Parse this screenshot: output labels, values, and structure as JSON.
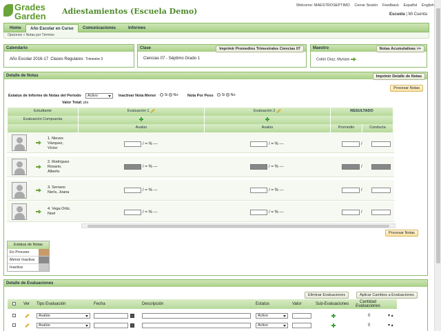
{
  "app": {
    "logo_line1": "Grades",
    "logo_line2": "Garden",
    "title": "Adiestamientos (Escuela Demo)"
  },
  "toplinks": {
    "welcome": "Welcome: MAESTROSEPTIMO",
    "logout": "Cerrar Sesión",
    "feedback": "Feedback",
    "spanish": "Español",
    "english": "English",
    "school": "Escuela",
    "sep": "|",
    "account": "Mi Cuenta"
  },
  "nav": {
    "tabs": [
      "Home",
      "Año Escolar en Curso",
      "Comunicaciones",
      "Informes"
    ],
    "breadcrumb_1": "Opciones",
    "breadcrumb_sep": "»",
    "breadcrumb_2": "Notas por Término"
  },
  "calendario": {
    "title": "Calendario",
    "year": "Año Escolar 2016-17",
    "program": "Clases Regulares",
    "term": "Trimestre 3"
  },
  "clase": {
    "title": "Clase",
    "print_button": "Imprimir Promedios Trimestrales Ciencias 07",
    "value": "Ciencias 07 - Séptimo Grado 1"
  },
  "maestro": {
    "title": "Maestro",
    "button": "Notas Acumulativas >>",
    "name": "Colón Díaz, Myriam"
  },
  "detalle_notas": {
    "title": "Detalle de Notas",
    "print_button": "Imprimir Detalle de Notas",
    "process_button": "Procesar Notas",
    "estatus_label": "Estatus de Informe de Notas del Periodo",
    "estatus_value": "Activo",
    "inactivar_label": "Inactivar Nota Menor",
    "nota_peso_label": "Nota Por Peso",
    "si": "Si",
    "no": "No",
    "valor_total_label": "Valor Total:",
    "valor_total_value": "pts",
    "col_estudiante": "Estudiante",
    "col_eval1": "Evaluación 1",
    "col_eval2": "Evaluación 2",
    "col_resultado": "RESULTADO",
    "col_eval_compuesta": "Evaluación Compuesta",
    "col_avaluo1": "Avalúo",
    "col_avaluo2": "Avalúo",
    "col_promedio": "Promedio",
    "col_conducta": "Conducta",
    "score_suffix": "/ = % ---",
    "slash": "/",
    "students": [
      {
        "line1": "1. Nieves",
        "line2": "Vázquez,",
        "line3": "Víctor"
      },
      {
        "line1": "2. Rodríguez",
        "line2": "Rosario,",
        "line3": "Alberto"
      },
      {
        "line1": "3. Serrano",
        "line2": "Nerís, Joana",
        "line3": ""
      },
      {
        "line1": "4. Vega Ortiz,",
        "line2": "Noel",
        "line3": ""
      }
    ],
    "process_button_bottom": "Procesar Notas"
  },
  "legend": {
    "title": "Estatus de Notas",
    "items": [
      {
        "label": "En Proceso",
        "color": "#c89a6a"
      },
      {
        "label": "Menor Inactiva",
        "color": "#8a8a8a"
      },
      {
        "label": "Inactiva",
        "color": "#c9c9c9"
      }
    ]
  },
  "detalle_eval": {
    "title": "Detalle de Evaluaciones",
    "delete_button": "Eliminar Evaluaciones",
    "apply_button": "Aplicar Cambios a Evaluaciones",
    "col_ver": "Ver",
    "col_tipo": "Tipo Evaluación",
    "col_fecha": "Fecha",
    "col_desc": "Descripción",
    "col_estatus": "Estatus",
    "col_valor": "Valor",
    "col_sub": "Sub-Evaluaciones",
    "col_cantidad": "Cantidad Evaluaciones",
    "rows": [
      {
        "tipo": "Avalúo",
        "estatus": "Activo",
        "cantidad": "0"
      },
      {
        "tipo": "Avalúo",
        "estatus": "Activo",
        "cantidad": "0"
      }
    ]
  }
}
